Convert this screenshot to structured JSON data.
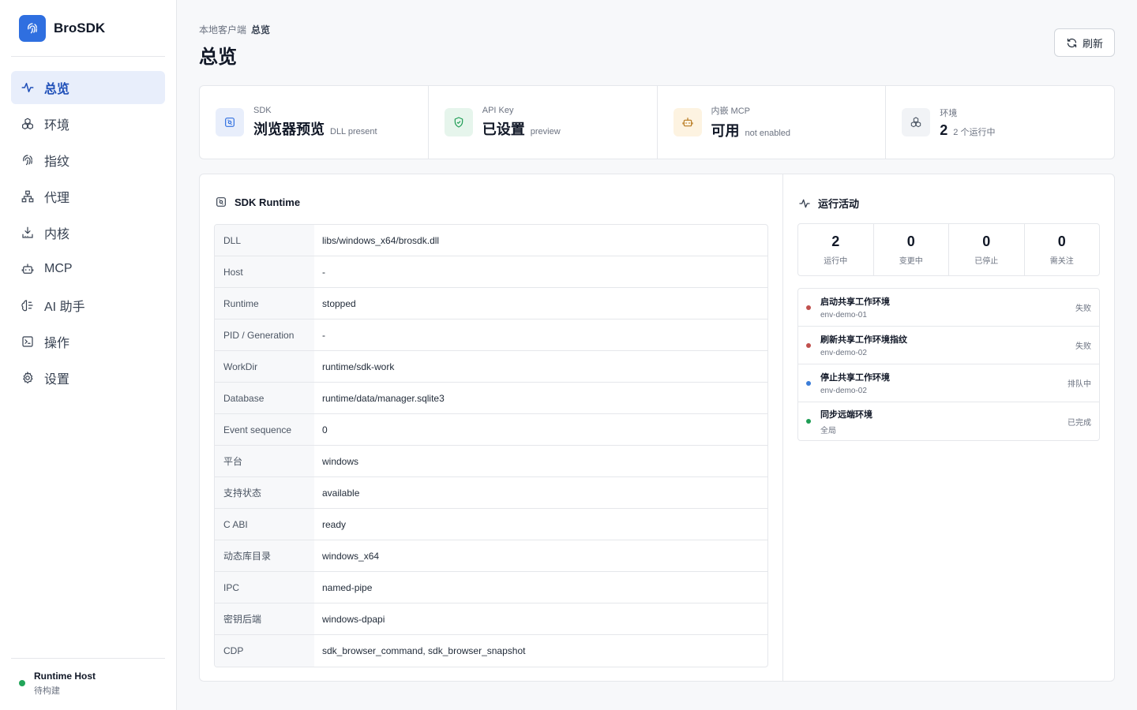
{
  "brand": {
    "name": "BroSDK",
    "logo_icon": "fingerprint-icon",
    "color": "#2f6fe0"
  },
  "nav": [
    {
      "label": "总览",
      "icon": "activity-icon",
      "active": true
    },
    {
      "label": "环境",
      "icon": "cubes-icon"
    },
    {
      "label": "指纹",
      "icon": "fingerprint-icon"
    },
    {
      "label": "代理",
      "icon": "network-icon"
    },
    {
      "label": "内核",
      "icon": "download-tray-icon"
    },
    {
      "label": "MCP",
      "icon": "bot-icon"
    },
    {
      "label": "AI 助手",
      "icon": "brain-icon"
    },
    {
      "label": "操作",
      "icon": "terminal-icon"
    },
    {
      "label": "设置",
      "icon": "gear-icon"
    }
  ],
  "runtime_host": {
    "title": "Runtime Host",
    "status": "待构建",
    "status_color": "#22a559"
  },
  "header": {
    "breadcrumb_parent": "本地客户端",
    "breadcrumb_current": "总览",
    "title": "总览",
    "refresh_label": "刷新"
  },
  "stats": [
    {
      "label": "SDK",
      "value": "浏览器预览",
      "sub": "DLL present",
      "icon": "sdk-chip-icon",
      "icon_bg": "#e8eefb",
      "icon_color": "#2f6fe0"
    },
    {
      "label": "API Key",
      "value": "已设置",
      "sub": "preview",
      "icon": "shield-check-icon",
      "icon_bg": "#e6f5ec",
      "icon_color": "#1f9d55"
    },
    {
      "label": "内嵌 MCP",
      "value": "可用",
      "sub": "not enabled",
      "icon": "bot-icon",
      "icon_bg": "#fdf3e1",
      "icon_color": "#b7791f"
    },
    {
      "label": "环境",
      "value": "2",
      "sub": "2 个运行中",
      "icon": "cubes-icon",
      "icon_bg": "#f1f3f6",
      "icon_color": "#4b5563"
    }
  ],
  "sdk_runtime": {
    "title": "SDK Runtime",
    "rows": [
      {
        "key": "DLL",
        "value": "libs/windows_x64/brosdk.dll"
      },
      {
        "key": "Host",
        "value": "-"
      },
      {
        "key": "Runtime",
        "value": "stopped"
      },
      {
        "key": "PID / Generation",
        "value": "-"
      },
      {
        "key": "WorkDir",
        "value": "runtime/sdk-work"
      },
      {
        "key": "Database",
        "value": "runtime/data/manager.sqlite3"
      },
      {
        "key": "Event sequence",
        "value": "0"
      },
      {
        "key": "平台",
        "value": "windows"
      },
      {
        "key": "支持状态",
        "value": "available"
      },
      {
        "key": "C ABI",
        "value": "ready"
      },
      {
        "key": "动态库目录",
        "value": "windows_x64"
      },
      {
        "key": "IPC",
        "value": "named-pipe"
      },
      {
        "key": "密钥后端",
        "value": "windows-dpapi"
      },
      {
        "key": "CDP",
        "value": "sdk_browser_command, sdk_browser_snapshot"
      }
    ]
  },
  "activity": {
    "title": "运行活动",
    "counters": [
      {
        "num": "2",
        "label": "运行中"
      },
      {
        "num": "0",
        "label": "变更中"
      },
      {
        "num": "0",
        "label": "已停止"
      },
      {
        "num": "0",
        "label": "需关注"
      }
    ],
    "items": [
      {
        "title": "启动共享工作环境",
        "sub": "env-demo-01",
        "status": "失败",
        "color": "#c0504d"
      },
      {
        "title": "刷新共享工作环境指纹",
        "sub": "env-demo-02",
        "status": "失败",
        "color": "#c0504d"
      },
      {
        "title": "停止共享工作环境",
        "sub": "env-demo-02",
        "status": "排队中",
        "color": "#3b7dd8"
      },
      {
        "title": "同步远端环境",
        "sub": "全局",
        "status": "已完成",
        "color": "#1f9d55"
      }
    ]
  }
}
